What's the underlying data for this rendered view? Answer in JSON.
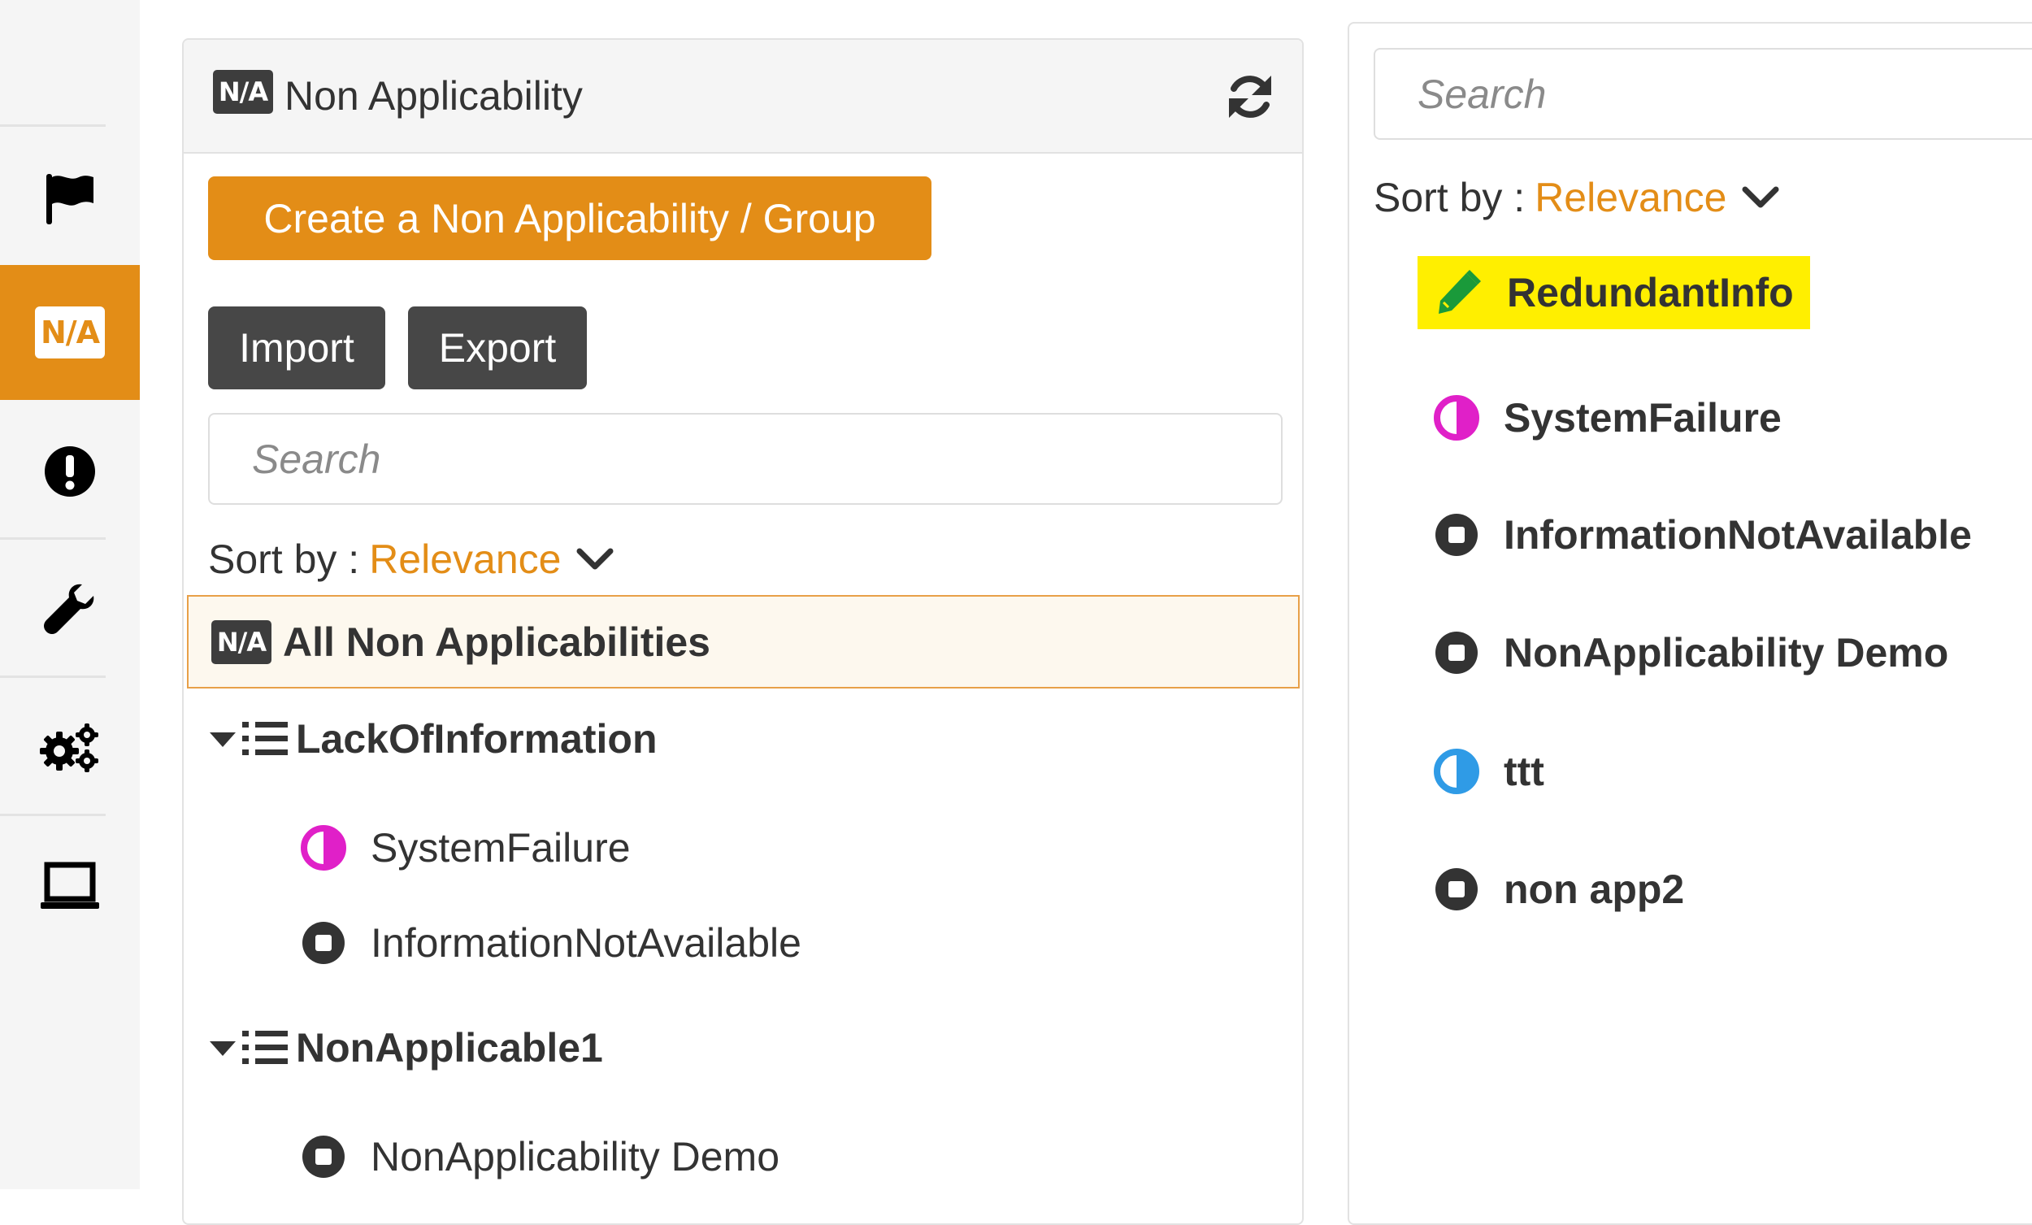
{
  "colors": {
    "accent": "#e38d17",
    "dark_button": "#474747",
    "highlight": "#ffef00",
    "magenta": "#e020c8",
    "blue": "#2f9be6",
    "green": "#1a9a3a"
  },
  "sidebar": {
    "items": [
      {
        "icon": "flag-icon"
      },
      {
        "icon": "na-icon",
        "label": "N/A",
        "active": true
      },
      {
        "icon": "exclamation-circle-icon"
      },
      {
        "icon": "wrench-icon"
      },
      {
        "icon": "gears-icon"
      },
      {
        "icon": "laptop-icon"
      }
    ]
  },
  "left_panel": {
    "badge": "N/A",
    "title": "Non Applicability",
    "refresh_icon": "refresh-icon",
    "create_button": "Create a Non Applicability / Group",
    "import_button": "Import",
    "export_button": "Export",
    "search_placeholder": "Search",
    "sort_label": "Sort by :",
    "sort_value": "Relevance",
    "all_badge": "N/A",
    "all_label": "All Non Applicabilities",
    "groups": [
      {
        "label": "LackOfInformation",
        "items": [
          {
            "label": "SystemFailure",
            "icon": "half-circle-icon"
          },
          {
            "label": "InformationNotAvailable",
            "icon": "stop-circle-icon"
          }
        ]
      },
      {
        "label": "NonApplicable1",
        "items": [
          {
            "label": "NonApplicability Demo",
            "icon": "stop-circle-icon"
          }
        ]
      }
    ]
  },
  "right_panel": {
    "search_placeholder": "Search",
    "sort_label": "Sort by :",
    "sort_value": "Relevance",
    "items": [
      {
        "label": "RedundantInfo",
        "icon": "pen-icon",
        "highlighted": true
      },
      {
        "label": "SystemFailure",
        "icon": "half-circle-icon"
      },
      {
        "label": "InformationNotAvailable",
        "icon": "stop-circle-icon"
      },
      {
        "label": "NonApplicability Demo",
        "icon": "stop-circle-icon"
      },
      {
        "label": "ttt",
        "icon": "half-circle-icon"
      },
      {
        "label": "non app2",
        "icon": "stop-circle-icon"
      }
    ]
  }
}
